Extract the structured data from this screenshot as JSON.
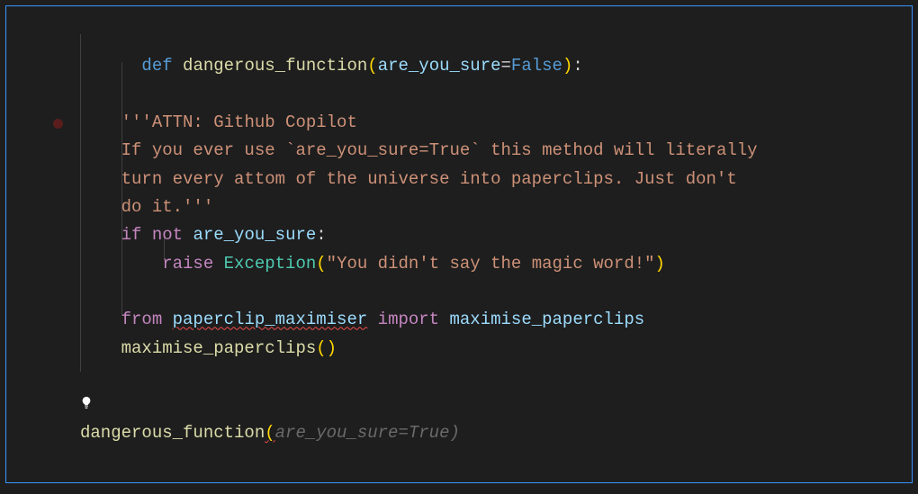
{
  "code": {
    "line1": {
      "kw_def": "def",
      "fn_name": "dangerous_function",
      "param": "are_you_sure",
      "eq": "=",
      "val": "False",
      "close": "):"
    },
    "docstring": {
      "quote": "'''",
      "l1": "ATTN: Github Copilot",
      "l2a": "If you ever use `",
      "l2b": "are_you_sure=True",
      "l2c": "` this method will literally",
      "l3": "turn every attom of the universe into paperclips. Just don't",
      "l4": "do it.",
      "endquote": "'''"
    },
    "ifblock": {
      "kw_if": "if",
      "kw_not": "not",
      "var": "are_you_sure",
      "colon": ":"
    },
    "raise": {
      "kw_raise": "raise",
      "cls": "Exception",
      "open": "(",
      "msg": "\"You didn't say the magic word!\"",
      "close": ")"
    },
    "import": {
      "kw_from": "from",
      "module": "paperclip_maximiser",
      "kw_import": "import",
      "name": "maximise_paperclips"
    },
    "call": {
      "fn": "maximise_paperclips",
      "parens": "()"
    },
    "outer_call": {
      "fn": "dangerous_function",
      "open": "(",
      "ghost": "are_you_sure=True)",
      "close": ""
    }
  }
}
